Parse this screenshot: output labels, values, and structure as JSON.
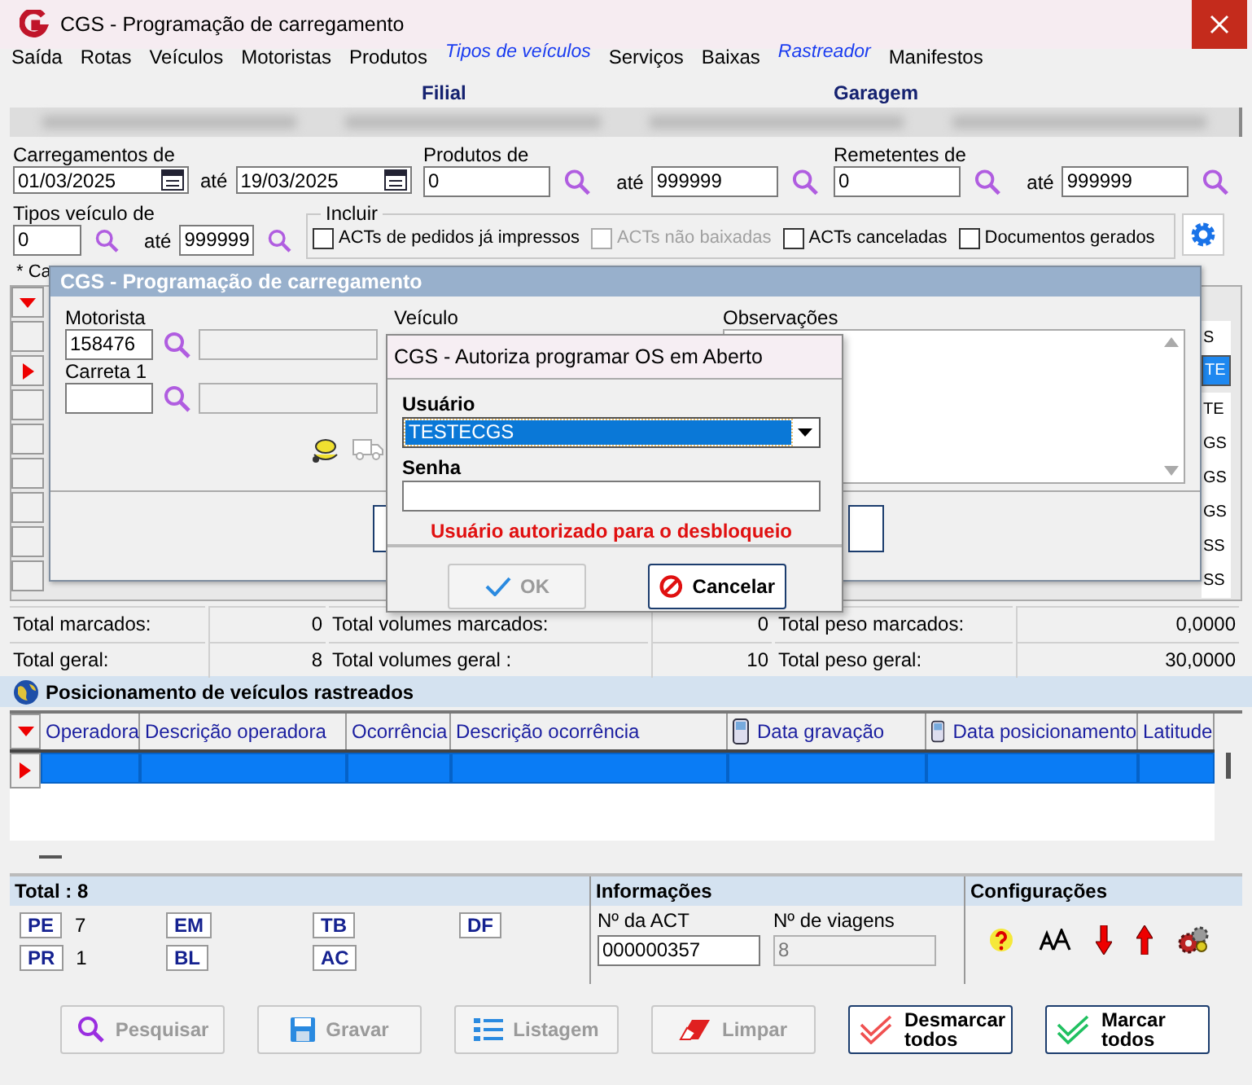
{
  "window": {
    "title": "CGS - Programação de carregamento"
  },
  "menu": [
    {
      "label": "Saída",
      "kind": "normal"
    },
    {
      "label": "Rotas",
      "kind": "normal"
    },
    {
      "label": "Veículos",
      "kind": "normal"
    },
    {
      "label": "Motoristas",
      "kind": "normal"
    },
    {
      "label": "Produtos",
      "kind": "normal"
    },
    {
      "label": "Tipos de veículos",
      "kind": "link"
    },
    {
      "label": "Serviços",
      "kind": "normal"
    },
    {
      "label": "Baixas",
      "kind": "normal"
    },
    {
      "label": "Rastreador",
      "kind": "link"
    },
    {
      "label": "Manifestos",
      "kind": "normal"
    }
  ],
  "filter": {
    "filial_label": "Filial",
    "garagem_label": "Garagem",
    "ranges": [
      {
        "label": "Carregamentos de",
        "from": "01/03/2025",
        "to_label": "até",
        "to": "19/03/2025",
        "kind": "date"
      },
      {
        "label": "Produtos de",
        "from": "0",
        "to_label": "até",
        "to": "999999",
        "kind": "lookup"
      },
      {
        "label": "Remetentes de",
        "from": "0",
        "to_label": "até",
        "to": "999999",
        "kind": "lookup"
      }
    ],
    "tipos": {
      "label": "Tipos veículo de",
      "from": "0",
      "to_label": "até",
      "to": "999999"
    },
    "incluir": {
      "label": "Incluir",
      "options": [
        {
          "label": "ACTs de pedidos já impressos",
          "checked": false,
          "disabled": false
        },
        {
          "label": "ACTs não baixadas",
          "checked": false,
          "disabled": true
        },
        {
          "label": "ACTs canceladas",
          "checked": false,
          "disabled": false
        },
        {
          "label": "Documentos gerados",
          "checked": false,
          "disabled": false
        }
      ]
    }
  },
  "grid_caption": "* Ca",
  "grid_rows": [
    {
      "cell": "S",
      "selected": false
    },
    {
      "cell": "TE",
      "selected": true
    },
    {
      "cell": "TE",
      "selected": false
    },
    {
      "cell": "GS",
      "selected": false
    },
    {
      "cell": "GS",
      "selected": false
    },
    {
      "cell": "GS",
      "selected": false
    },
    {
      "cell": "SS",
      "selected": false
    },
    {
      "cell": "SS",
      "selected": false
    }
  ],
  "totals": [
    [
      {
        "label": "Total marcados:",
        "value": "0"
      },
      {
        "label": "Total volumes marcados:",
        "value": "0"
      },
      {
        "label": "Total peso marcados:",
        "value": "0,0000"
      }
    ],
    [
      {
        "label": "Total geral:",
        "value": "8"
      },
      {
        "label": "Total volumes geral :",
        "value": "10"
      },
      {
        "label": "Total peso geral:",
        "value": "30,0000"
      }
    ]
  ],
  "tracking": {
    "title": "Posicionamento de veículos rastreados",
    "columns": [
      {
        "label": "Operadora",
        "icon": false
      },
      {
        "label": "Descrição operadora",
        "icon": false
      },
      {
        "label": "Ocorrência",
        "icon": false
      },
      {
        "label": "Descrição ocorrência",
        "icon": false
      },
      {
        "label": "Data gravação",
        "icon": true
      },
      {
        "label": "Data posicionamento",
        "icon": true
      },
      {
        "label": "Latitude",
        "icon": false
      }
    ],
    "rows": [
      {
        "selected": true
      }
    ]
  },
  "summary": {
    "title": "Total : 8",
    "statuses": [
      {
        "code": "PE",
        "count": "7"
      },
      {
        "code": "EM"
      },
      {
        "code": "TB"
      },
      {
        "code": "DF"
      },
      {
        "code": "PR",
        "count": "1"
      },
      {
        "code": "BL"
      },
      {
        "code": "AC"
      }
    ]
  },
  "info": {
    "title": "Informações",
    "act_label": "Nº da ACT",
    "act": "000000357",
    "trips_label": "Nº de viagens",
    "trips": "8"
  },
  "config": {
    "title": "Configurações"
  },
  "buttons": [
    {
      "label": "Pesquisar",
      "kind": "search",
      "disabled": true
    },
    {
      "label": "Gravar",
      "kind": "save",
      "disabled": true
    },
    {
      "label": "Listagem",
      "kind": "list",
      "disabled": true
    },
    {
      "label": "Limpar",
      "kind": "clear",
      "disabled": true
    },
    {
      "label": "Desmarcar todos",
      "kind": "uncheck",
      "disabled": false
    },
    {
      "label": "Marcar todos",
      "kind": "check",
      "disabled": false
    }
  ],
  "dialog": {
    "title": "CGS - Programação de carregamento",
    "motorista_label": "Motorista",
    "motorista": "158476",
    "carreta_label": "Carreta 1",
    "veiculo_label": "Veículo",
    "obs_label": "Observações"
  },
  "auth": {
    "title": "CGS - Autoriza programar OS em Aberto",
    "user_label": "Usuário",
    "user": "TESTECGS",
    "pass_label": "Senha",
    "message": "Usuário autorizado para o desbloqueio",
    "ok": {
      "label": "OK",
      "disabled": true
    },
    "cancel": {
      "label": "Cancelar",
      "disabled": false
    }
  }
}
